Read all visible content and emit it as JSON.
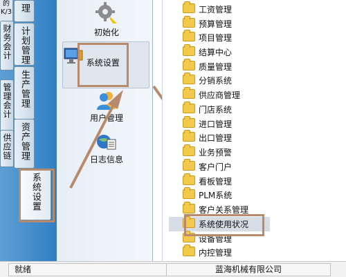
{
  "left_tabs": {
    "top_label": "的\nK/3",
    "tab1": "理",
    "tab2": "计划管理",
    "tab3": "财务会计",
    "tab4": "生产管理",
    "tab5": "管理会计",
    "tab6": "资产管理",
    "tab7": "供应链",
    "tab8": "系统设置"
  },
  "tools": [
    {
      "label": "初始化",
      "icon": "gear-icon"
    },
    {
      "label": "系统设置",
      "icon": "monitor-settings-icon"
    },
    {
      "label": "用户管理",
      "icon": "users-icon"
    },
    {
      "label": "日志信息",
      "icon": "log-icon"
    }
  ],
  "tree_items": [
    "工资管理",
    "预算管理",
    "项目管理",
    "结算中心",
    "质量管理",
    "分销系统",
    "供应商管理",
    "门店系统",
    "进口管理",
    "出口管理",
    "业务预警",
    "客户门户",
    "看板管理",
    "PLM系统",
    "客户关系管理",
    "系统使用状况",
    "设备管理",
    "内控管理"
  ],
  "status": {
    "left": "就绪",
    "center": "蓝海机械有限公司"
  },
  "colors": {
    "annotation": "#b88a6c"
  }
}
